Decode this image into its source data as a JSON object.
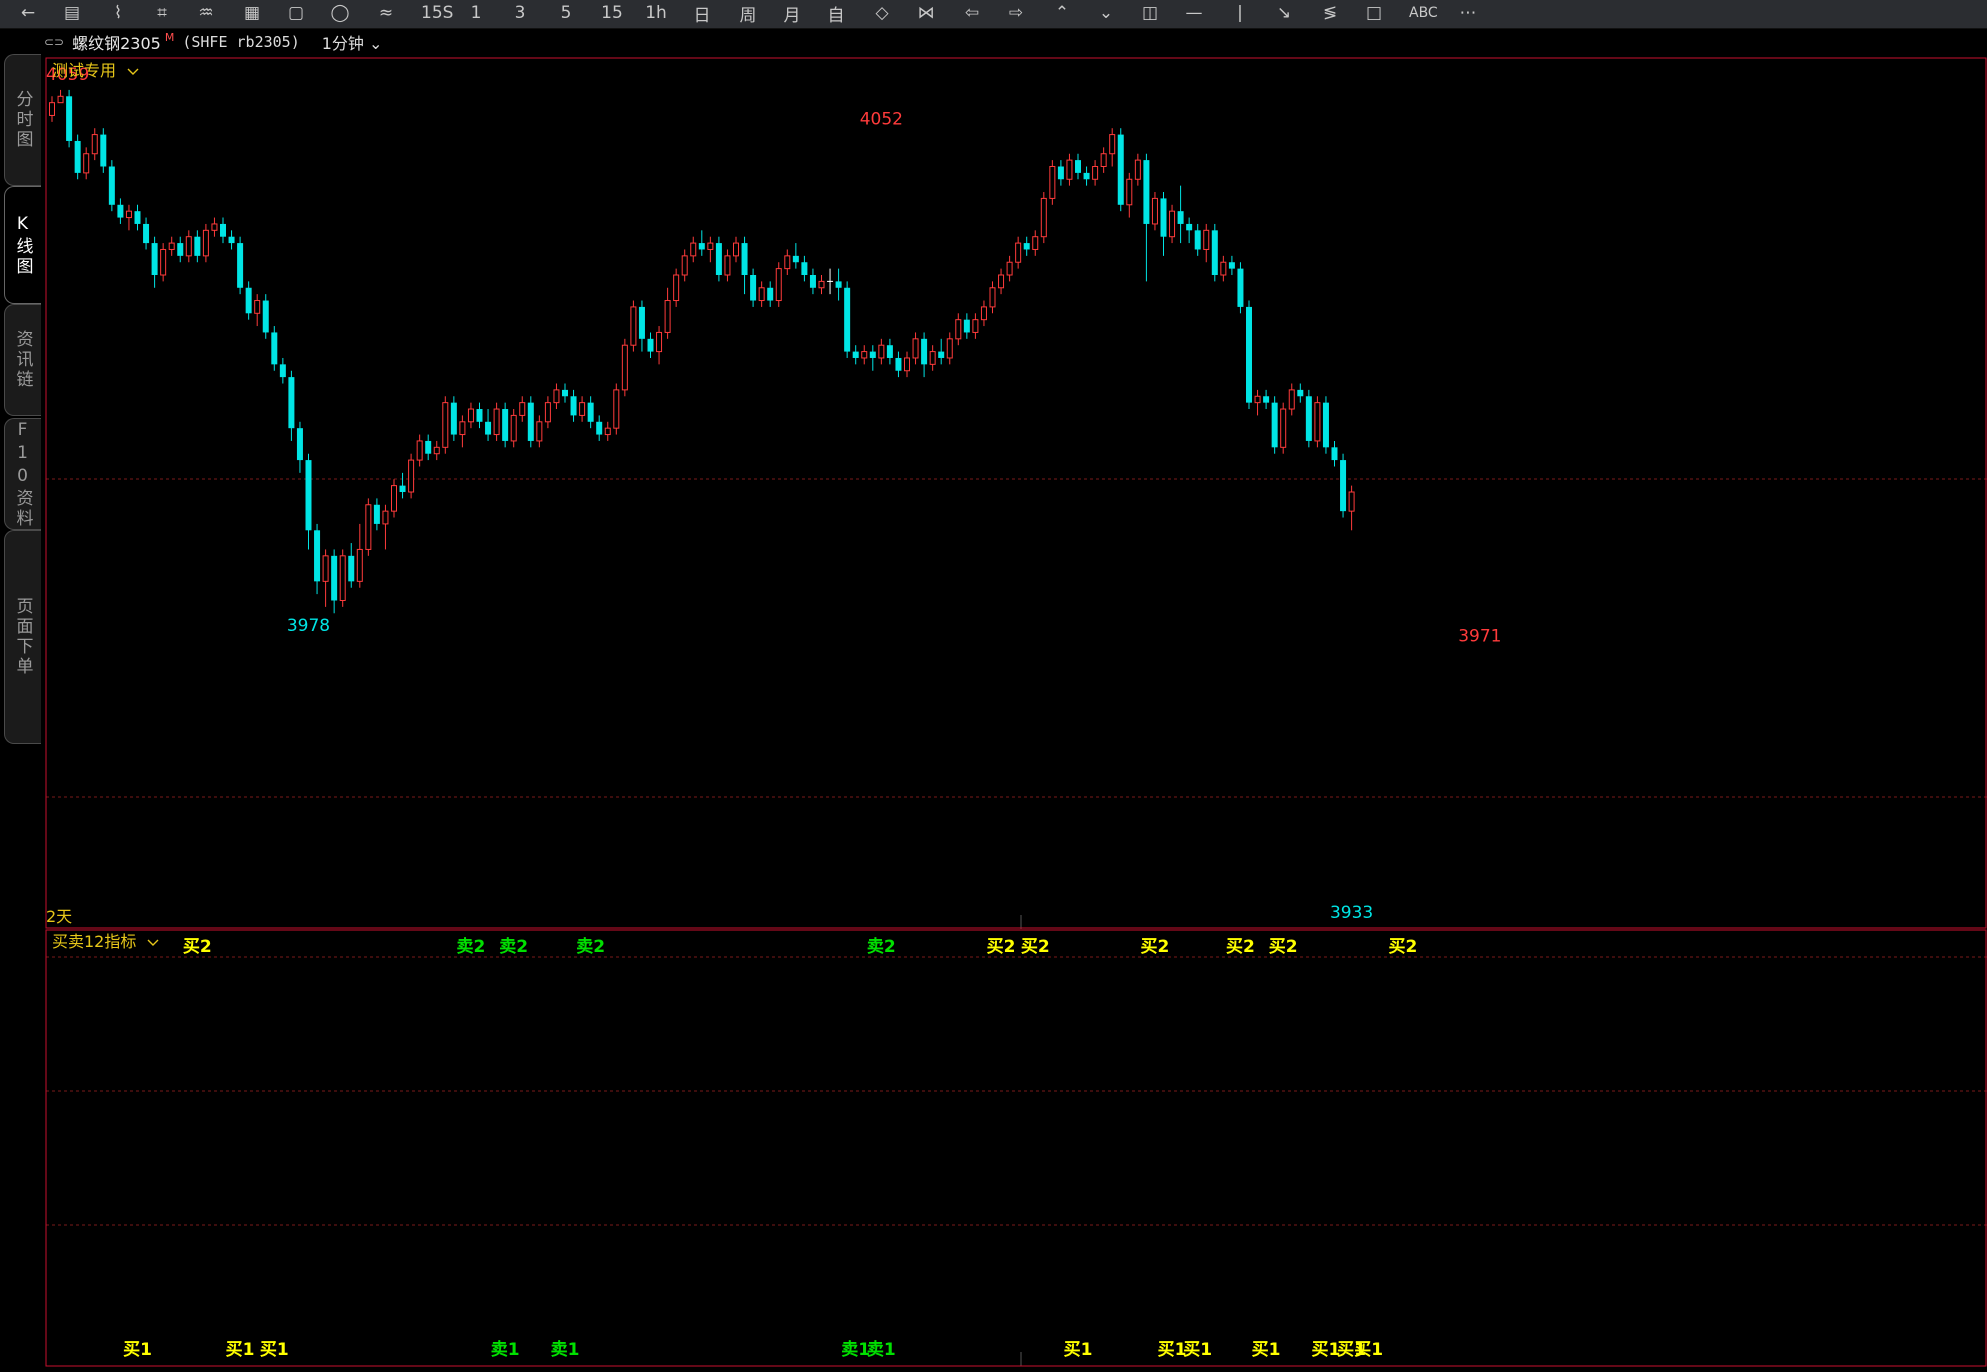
{
  "toolbar": {
    "items": [
      {
        "name": "back-icon",
        "glyph": "←"
      },
      {
        "name": "list-icon",
        "glyph": "▤"
      },
      {
        "name": "line-chart-icon",
        "glyph": "⌇"
      },
      {
        "name": "candle-icon",
        "glyph": "⌗"
      },
      {
        "name": "indicator-icon",
        "glyph": "♒"
      },
      {
        "name": "stat-icon",
        "glyph": "▦"
      },
      {
        "name": "save-icon",
        "glyph": "▢"
      },
      {
        "name": "circle-icon",
        "glyph": "◯"
      },
      {
        "name": "wave-icon",
        "glyph": "≈"
      },
      {
        "name": "period-15s",
        "label": "15S"
      },
      {
        "name": "period-1",
        "label": "1"
      },
      {
        "name": "period-3",
        "label": "3"
      },
      {
        "name": "period-5",
        "label": "5"
      },
      {
        "name": "period-15",
        "label": "15"
      },
      {
        "name": "period-1h",
        "label": "1h"
      },
      {
        "name": "period-day",
        "label": "日"
      },
      {
        "name": "period-week",
        "label": "周"
      },
      {
        "name": "period-month",
        "label": "月"
      },
      {
        "name": "period-custom",
        "label": "自"
      },
      {
        "name": "zoom-in-icon",
        "glyph": "◇"
      },
      {
        "name": "zoom-out-icon",
        "glyph": "⋈"
      },
      {
        "name": "arrow-left-icon",
        "glyph": "⇦"
      },
      {
        "name": "arrow-right-icon",
        "glyph": "⇨"
      },
      {
        "name": "arrow-up-icon",
        "glyph": "⌃"
      },
      {
        "name": "arrow-down-icon",
        "glyph": "⌄"
      },
      {
        "name": "layout-icon",
        "glyph": "◫"
      },
      {
        "name": "hline-icon",
        "glyph": "—"
      },
      {
        "name": "vline-icon",
        "glyph": "|"
      },
      {
        "name": "ray-icon",
        "glyph": "↘"
      },
      {
        "name": "channel-icon",
        "glyph": "≶"
      },
      {
        "name": "rect-icon",
        "glyph": "□"
      },
      {
        "name": "text-icon",
        "label": "ABC"
      },
      {
        "name": "more-icon",
        "glyph": "⋯"
      }
    ]
  },
  "infobar": {
    "link_glyph": "⊂⊃",
    "symbol": "螺纹钢2305",
    "flag": "M",
    "code": "(SHFE rb2305)",
    "period": "1分钟"
  },
  "sidebar": {
    "tabs": [
      {
        "name": "tab-minute-chart",
        "label": "分时图",
        "active": false
      },
      {
        "name": "tab-kline-chart",
        "label": "K线图",
        "active": true
      },
      {
        "name": "tab-news-chain",
        "label": "资讯链",
        "active": false
      },
      {
        "name": "tab-f10",
        "label": "F10资料",
        "active": false
      },
      {
        "name": "tab-page-order",
        "label": "页面下单",
        "active": false
      }
    ]
  },
  "main_pane": {
    "template": "测试专用",
    "days_label": "2天",
    "colors": {
      "up": "#ff3b3b",
      "down": "#00e5e5",
      "border": "#c8102e",
      "grid": "#7a1a1a",
      "annot_high": "#ff3b3b",
      "annot_low": "#00e5e5"
    }
  },
  "indicator_pane": {
    "name": "买卖12指标",
    "colors": {
      "buy": "#ffff00",
      "sell": "#00e000"
    },
    "top_signals": [
      {
        "i": 17,
        "text": "买2",
        "type": "buy"
      },
      {
        "i": 49,
        "text": "卖2",
        "type": "sell"
      },
      {
        "i": 54,
        "text": "卖2",
        "type": "sell"
      },
      {
        "i": 63,
        "text": "卖2",
        "type": "sell"
      },
      {
        "i": 97,
        "text": "卖2",
        "type": "sell"
      },
      {
        "i": 111,
        "text": "买2",
        "type": "buy"
      },
      {
        "i": 115,
        "text": "买2",
        "type": "buy"
      },
      {
        "i": 129,
        "text": "买2",
        "type": "buy"
      },
      {
        "i": 139,
        "text": "买2",
        "type": "buy"
      },
      {
        "i": 144,
        "text": "买2",
        "type": "buy"
      },
      {
        "i": 158,
        "text": "买2",
        "type": "buy"
      }
    ],
    "bottom_signals": [
      {
        "i": 10,
        "text": "买1",
        "type": "buy"
      },
      {
        "i": 22,
        "text": "买1",
        "type": "buy"
      },
      {
        "i": 26,
        "text": "买1",
        "type": "buy"
      },
      {
        "i": 53,
        "text": "卖1",
        "type": "sell"
      },
      {
        "i": 60,
        "text": "卖1",
        "type": "sell"
      },
      {
        "i": 94,
        "text": "卖1",
        "type": "sell"
      },
      {
        "i": 97,
        "text": "卖1",
        "type": "sell"
      },
      {
        "i": 120,
        "text": "买1",
        "type": "buy"
      },
      {
        "i": 131,
        "text": "买1",
        "type": "buy"
      },
      {
        "i": 134,
        "text": "买1",
        "type": "buy"
      },
      {
        "i": 142,
        "text": "买1",
        "type": "buy"
      },
      {
        "i": 149,
        "text": "买1",
        "type": "buy"
      },
      {
        "i": 152,
        "text": "买1",
        "type": "buy"
      },
      {
        "i": 154,
        "text": "买1",
        "type": "buy"
      }
    ]
  },
  "chart_data": {
    "type": "candlestick",
    "symbol": "rb2305",
    "period": "1分钟",
    "ylim": [
      3928,
      4064
    ],
    "annotations": [
      {
        "i": 1,
        "value": 4059,
        "kind": "high"
      },
      {
        "i": 30,
        "value": 3978,
        "kind": "low"
      },
      {
        "i": 97,
        "value": 4052,
        "kind": "high"
      },
      {
        "i": 152,
        "value": 3933,
        "kind": "low"
      },
      {
        "i": 167,
        "value": 3971,
        "kind": "high"
      }
    ],
    "candles": [
      [
        4055,
        4057,
        4054,
        4058
      ],
      [
        4057,
        4058,
        4057,
        4059
      ],
      [
        4058,
        4051,
        4050,
        4059
      ],
      [
        4051,
        4046,
        4045,
        4052
      ],
      [
        4046,
        4049,
        4045,
        4050
      ],
      [
        4049,
        4052,
        4048,
        4053
      ],
      [
        4052,
        4047,
        4046,
        4053
      ],
      [
        4047,
        4041,
        4040,
        4048
      ],
      [
        4041,
        4039,
        4038,
        4042
      ],
      [
        4039,
        4040,
        4037,
        4041
      ],
      [
        4040,
        4038,
        4037,
        4041
      ],
      [
        4038,
        4035,
        4034,
        4039
      ],
      [
        4035,
        4030,
        4028,
        4036
      ],
      [
        4030,
        4034,
        4029,
        4035
      ],
      [
        4034,
        4035,
        4033,
        4036
      ],
      [
        4035,
        4033,
        4032,
        4036
      ],
      [
        4033,
        4036,
        4032,
        4037
      ],
      [
        4036,
        4033,
        4032,
        4037
      ],
      [
        4033,
        4037,
        4032,
        4038
      ],
      [
        4037,
        4038,
        4036,
        4039
      ],
      [
        4038,
        4036,
        4035,
        4039
      ],
      [
        4036,
        4035,
        4034,
        4037
      ],
      [
        4035,
        4028,
        4027,
        4036
      ],
      [
        4028,
        4024,
        4023,
        4029
      ],
      [
        4024,
        4026,
        4022,
        4027
      ],
      [
        4026,
        4021,
        4020,
        4027
      ],
      [
        4021,
        4016,
        4015,
        4022
      ],
      [
        4016,
        4014,
        4013,
        4017
      ],
      [
        4014,
        4006,
        4004,
        4015
      ],
      [
        4006,
        4001,
        3999,
        4007
      ],
      [
        4001,
        3990,
        3987,
        4002
      ],
      [
        3990,
        3982,
        3980,
        3991
      ],
      [
        3982,
        3986,
        3978,
        3987
      ],
      [
        3986,
        3979,
        3977,
        3987
      ],
      [
        3979,
        3986,
        3978,
        3987
      ],
      [
        3986,
        3982,
        3981,
        3988
      ],
      [
        3982,
        3987,
        3981,
        3991
      ],
      [
        3987,
        3994,
        3986,
        3995
      ],
      [
        3994,
        3991,
        3990,
        3995
      ],
      [
        3991,
        3993,
        3987,
        3994
      ],
      [
        3993,
        3997,
        3992,
        3998
      ],
      [
        3997,
        3996,
        3995,
        3999
      ],
      [
        3996,
        4001,
        3995,
        4002
      ],
      [
        4001,
        4004,
        4000,
        4005
      ],
      [
        4004,
        4002,
        4001,
        4005
      ],
      [
        4002,
        4003,
        4001,
        4004
      ],
      [
        4003,
        4010,
        4002,
        4011
      ],
      [
        4010,
        4005,
        4004,
        4011
      ],
      [
        4005,
        4007,
        4003,
        4008
      ],
      [
        4007,
        4009,
        4006,
        4010
      ],
      [
        4009,
        4007,
        4006,
        4010
      ],
      [
        4007,
        4005,
        4004,
        4009
      ],
      [
        4005,
        4009,
        4004,
        4010
      ],
      [
        4009,
        4004,
        4003,
        4010
      ],
      [
        4004,
        4008,
        4003,
        4009
      ],
      [
        4008,
        4010,
        4007,
        4011
      ],
      [
        4010,
        4004,
        4003,
        4011
      ],
      [
        4004,
        4007,
        4003,
        4008
      ],
      [
        4007,
        4010,
        4006,
        4011
      ],
      [
        4010,
        4012,
        4009,
        4013
      ],
      [
        4012,
        4011,
        4010,
        4013
      ],
      [
        4011,
        4008,
        4007,
        4012
      ],
      [
        4008,
        4010,
        4007,
        4011
      ],
      [
        4010,
        4007,
        4006,
        4011
      ],
      [
        4007,
        4005,
        4004,
        4008
      ],
      [
        4005,
        4006,
        4004,
        4007
      ],
      [
        4006,
        4012,
        4005,
        4013
      ],
      [
        4012,
        4019,
        4011,
        4020
      ],
      [
        4019,
        4025,
        4018,
        4026
      ],
      [
        4025,
        4020,
        4018,
        4026
      ],
      [
        4020,
        4018,
        4017,
        4021
      ],
      [
        4018,
        4021,
        4016,
        4022
      ],
      [
        4021,
        4026,
        4020,
        4028
      ],
      [
        4026,
        4030,
        4025,
        4031
      ],
      [
        4030,
        4033,
        4029,
        4034
      ],
      [
        4033,
        4035,
        4032,
        4036
      ],
      [
        4035,
        4034,
        4033,
        4037
      ],
      [
        4034,
        4035,
        4032,
        4036
      ],
      [
        4035,
        4030,
        4029,
        4036
      ],
      [
        4030,
        4033,
        4029,
        4034
      ],
      [
        4033,
        4035,
        4032,
        4036
      ],
      [
        4035,
        4030,
        4027,
        4036
      ],
      [
        4030,
        4026,
        4025,
        4031
      ],
      [
        4026,
        4028,
        4025,
        4029
      ],
      [
        4028,
        4026,
        4025,
        4029
      ],
      [
        4026,
        4031,
        4025,
        4032
      ],
      [
        4031,
        4033,
        4030,
        4034
      ],
      [
        4033,
        4032,
        4031,
        4035
      ],
      [
        4032,
        4030,
        4029,
        4033
      ],
      [
        4030,
        4028,
        4027,
        4031
      ],
      [
        4028,
        4029,
        4027,
        4030
      ],
      [
        4029,
        4029,
        4027,
        4031
      ],
      [
        4029,
        4028,
        4026,
        4031
      ],
      [
        4028,
        4018,
        4017,
        4029
      ],
      [
        4018,
        4017,
        4016,
        4019
      ],
      [
        4017,
        4018,
        4016,
        4019
      ],
      [
        4018,
        4017,
        4015,
        4019
      ],
      [
        4017,
        4019,
        4016,
        4020
      ],
      [
        4019,
        4017,
        4016,
        4020
      ],
      [
        4017,
        4015,
        4014,
        4018
      ],
      [
        4015,
        4017,
        4014,
        4018
      ],
      [
        4017,
        4020,
        4016,
        4021
      ],
      [
        4020,
        4016,
        4014,
        4021
      ],
      [
        4016,
        4018,
        4015,
        4019
      ],
      [
        4018,
        4017,
        4016,
        4020
      ],
      [
        4017,
        4020,
        4016,
        4021
      ],
      [
        4020,
        4023,
        4019,
        4024
      ],
      [
        4023,
        4021,
        4020,
        4024
      ],
      [
        4021,
        4023,
        4020,
        4024
      ],
      [
        4023,
        4025,
        4022,
        4026
      ],
      [
        4025,
        4028,
        4024,
        4029
      ],
      [
        4028,
        4030,
        4027,
        4031
      ],
      [
        4030,
        4032,
        4029,
        4033
      ],
      [
        4032,
        4035,
        4031,
        4036
      ],
      [
        4035,
        4034,
        4033,
        4036
      ],
      [
        4034,
        4036,
        4033,
        4037
      ],
      [
        4036,
        4042,
        4035,
        4043
      ],
      [
        4042,
        4047,
        4041,
        4048
      ],
      [
        4047,
        4045,
        4044,
        4048
      ],
      [
        4045,
        4048,
        4044,
        4049
      ],
      [
        4048,
        4046,
        4045,
        4049
      ],
      [
        4046,
        4045,
        4044,
        4047
      ],
      [
        4045,
        4047,
        4044,
        4048
      ],
      [
        4047,
        4049,
        4046,
        4050
      ],
      [
        4049,
        4052,
        4047,
        4053
      ],
      [
        4052,
        4041,
        4040,
        4053
      ],
      [
        4041,
        4045,
        4039,
        4046
      ],
      [
        4045,
        4048,
        4044,
        4049
      ],
      [
        4048,
        4038,
        4029,
        4049
      ],
      [
        4038,
        4042,
        4037,
        4043
      ],
      [
        4042,
        4036,
        4033,
        4043
      ],
      [
        4036,
        4040,
        4035,
        4041
      ],
      [
        4040,
        4038,
        4035,
        4044
      ],
      [
        4038,
        4037,
        4035,
        4039
      ],
      [
        4037,
        4034,
        4033,
        4038
      ],
      [
        4034,
        4037,
        4032,
        4038
      ],
      [
        4037,
        4030,
        4029,
        4038
      ],
      [
        4030,
        4032,
        4029,
        4033
      ],
      [
        4032,
        4031,
        4030,
        4033
      ],
      [
        4031,
        4025,
        4024,
        4032
      ],
      [
        4025,
        4010,
        4009,
        4026
      ],
      [
        4010,
        4011,
        4008,
        4012
      ],
      [
        4011,
        4010,
        4009,
        4012
      ],
      [
        4010,
        4003,
        4002,
        4011
      ],
      [
        4003,
        4009,
        4002,
        4010
      ],
      [
        4009,
        4012,
        4008,
        4013
      ],
      [
        4012,
        4011,
        4010,
        4013
      ],
      [
        4011,
        4004,
        4003,
        4012
      ],
      [
        4004,
        4010,
        4003,
        4011
      ],
      [
        4010,
        4003,
        4002,
        4011
      ],
      [
        4003,
        4001,
        4000,
        4004
      ],
      [
        4001,
        3993,
        3992,
        4002
      ],
      [
        3993,
        3996,
        3990,
        3997
      ]
    ]
  }
}
